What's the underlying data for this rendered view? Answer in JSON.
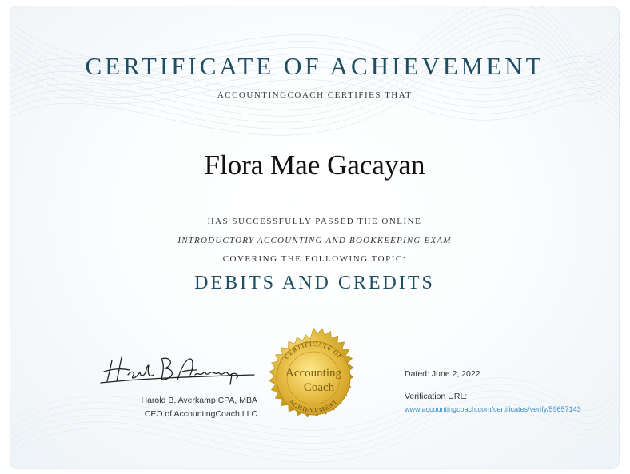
{
  "certificate": {
    "title": "CERTIFICATE OF ACHIEVEMENT",
    "certifies": "ACCOUNTINGCOACH CERTIFIES THAT",
    "recipient": "Flora Mae Gacayan",
    "passed": "HAS SUCCESSFULLY PASSED THE ONLINE",
    "exam": "INTRODUCTORY ACCOUNTING AND BOOKKEEPING EXAM",
    "covering": "COVERING THE FOLLOWING TOPIC:",
    "topic": "DEBITS AND CREDITS"
  },
  "signatory": {
    "name": "Harold B. Averkamp CPA, MBA",
    "title": "CEO of AccountingCoach LLC"
  },
  "seal": {
    "top_text": "CERTIFICATE OF",
    "brand_line1": "Accounting",
    "brand_line2": "Coach",
    "bottom_text": "ACHIEVEMENT"
  },
  "details": {
    "dated": "Dated: June 2, 2022",
    "verification_label": "Verification URL:",
    "verification_url": "www.accountingcoach.com/certificates/verify/59657143"
  },
  "colors": {
    "title": "#1f4e63",
    "link": "#3a8fc7",
    "seal_gold": "#d9b43a"
  }
}
